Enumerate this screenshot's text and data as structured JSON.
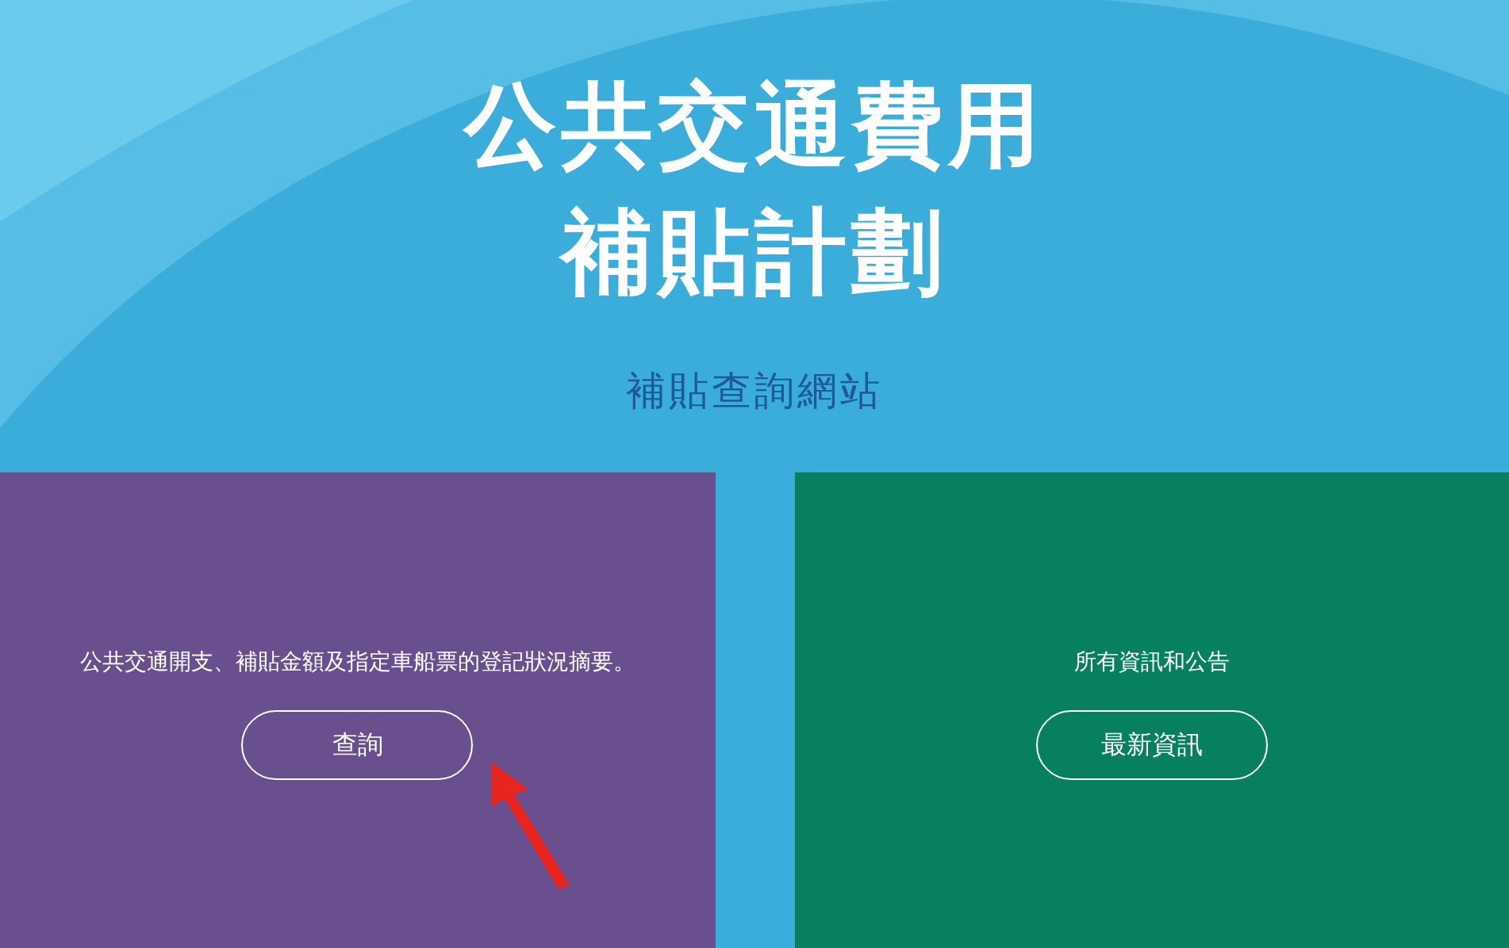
{
  "header": {
    "title_lines": [
      "公共交通費用",
      "補貼計劃"
    ],
    "subtitle": "補貼查詢網站"
  },
  "cards": [
    {
      "description": "公共交通開支、補貼金額及指定車船票的登記狀況摘要。",
      "button": "查詢",
      "color": "#6a4f8e"
    },
    {
      "description": "所有資訊和公告",
      "button": "最新資訊",
      "color": "#06805f"
    }
  ]
}
